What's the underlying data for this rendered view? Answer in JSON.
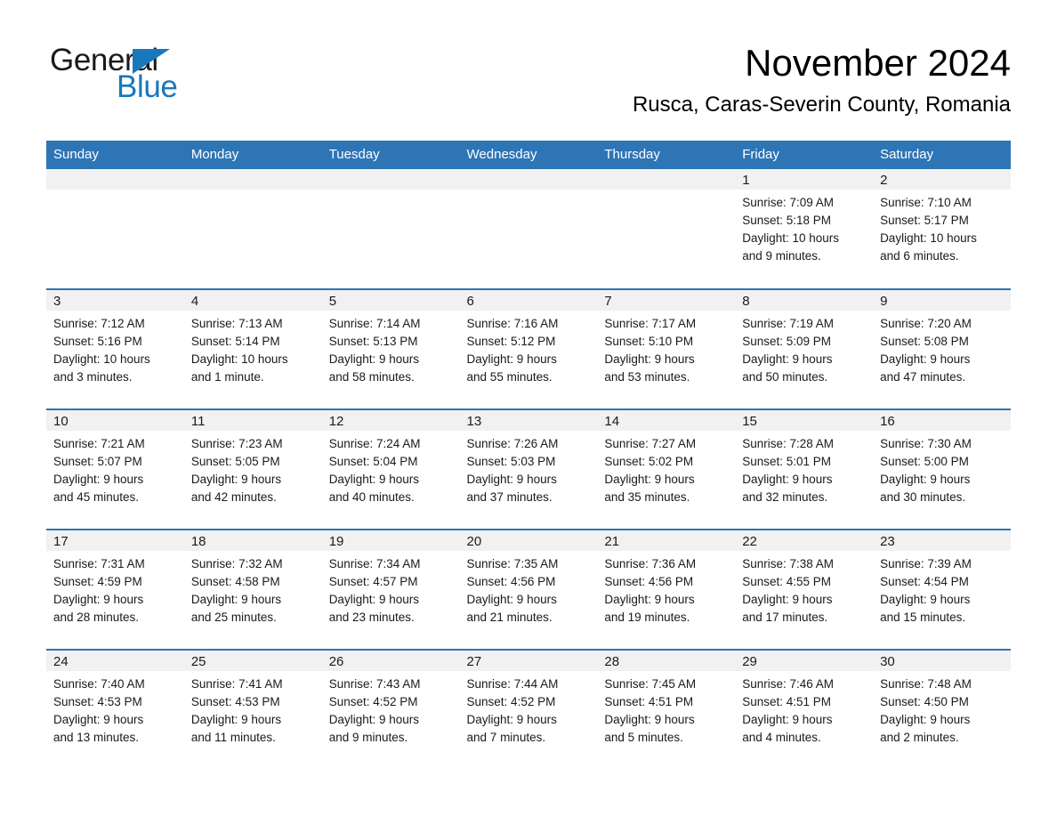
{
  "brand": {
    "name_part1": "General",
    "name_part2": "Blue",
    "accent_color": "#1878bd"
  },
  "header": {
    "title": "November 2024",
    "location": "Rusca, Caras-Severin County, Romania"
  },
  "theme": {
    "header_row_color": "#2e75b6",
    "daynum_band_color": "#f1f1f1",
    "separator_color": "#2e75b6"
  },
  "weekday_headers": [
    "Sunday",
    "Monday",
    "Tuesday",
    "Wednesday",
    "Thursday",
    "Friday",
    "Saturday"
  ],
  "weeks": [
    [
      {
        "day": "",
        "sunrise": "",
        "sunset": "",
        "daylight_line1": "",
        "daylight_line2": ""
      },
      {
        "day": "",
        "sunrise": "",
        "sunset": "",
        "daylight_line1": "",
        "daylight_line2": ""
      },
      {
        "day": "",
        "sunrise": "",
        "sunset": "",
        "daylight_line1": "",
        "daylight_line2": ""
      },
      {
        "day": "",
        "sunrise": "",
        "sunset": "",
        "daylight_line1": "",
        "daylight_line2": ""
      },
      {
        "day": "",
        "sunrise": "",
        "sunset": "",
        "daylight_line1": "",
        "daylight_line2": ""
      },
      {
        "day": "1",
        "sunrise": "Sunrise: 7:09 AM",
        "sunset": "Sunset: 5:18 PM",
        "daylight_line1": "Daylight: 10 hours",
        "daylight_line2": "and 9 minutes."
      },
      {
        "day": "2",
        "sunrise": "Sunrise: 7:10 AM",
        "sunset": "Sunset: 5:17 PM",
        "daylight_line1": "Daylight: 10 hours",
        "daylight_line2": "and 6 minutes."
      }
    ],
    [
      {
        "day": "3",
        "sunrise": "Sunrise: 7:12 AM",
        "sunset": "Sunset: 5:16 PM",
        "daylight_line1": "Daylight: 10 hours",
        "daylight_line2": "and 3 minutes."
      },
      {
        "day": "4",
        "sunrise": "Sunrise: 7:13 AM",
        "sunset": "Sunset: 5:14 PM",
        "daylight_line1": "Daylight: 10 hours",
        "daylight_line2": "and 1 minute."
      },
      {
        "day": "5",
        "sunrise": "Sunrise: 7:14 AM",
        "sunset": "Sunset: 5:13 PM",
        "daylight_line1": "Daylight: 9 hours",
        "daylight_line2": "and 58 minutes."
      },
      {
        "day": "6",
        "sunrise": "Sunrise: 7:16 AM",
        "sunset": "Sunset: 5:12 PM",
        "daylight_line1": "Daylight: 9 hours",
        "daylight_line2": "and 55 minutes."
      },
      {
        "day": "7",
        "sunrise": "Sunrise: 7:17 AM",
        "sunset": "Sunset: 5:10 PM",
        "daylight_line1": "Daylight: 9 hours",
        "daylight_line2": "and 53 minutes."
      },
      {
        "day": "8",
        "sunrise": "Sunrise: 7:19 AM",
        "sunset": "Sunset: 5:09 PM",
        "daylight_line1": "Daylight: 9 hours",
        "daylight_line2": "and 50 minutes."
      },
      {
        "day": "9",
        "sunrise": "Sunrise: 7:20 AM",
        "sunset": "Sunset: 5:08 PM",
        "daylight_line1": "Daylight: 9 hours",
        "daylight_line2": "and 47 minutes."
      }
    ],
    [
      {
        "day": "10",
        "sunrise": "Sunrise: 7:21 AM",
        "sunset": "Sunset: 5:07 PM",
        "daylight_line1": "Daylight: 9 hours",
        "daylight_line2": "and 45 minutes."
      },
      {
        "day": "11",
        "sunrise": "Sunrise: 7:23 AM",
        "sunset": "Sunset: 5:05 PM",
        "daylight_line1": "Daylight: 9 hours",
        "daylight_line2": "and 42 minutes."
      },
      {
        "day": "12",
        "sunrise": "Sunrise: 7:24 AM",
        "sunset": "Sunset: 5:04 PM",
        "daylight_line1": "Daylight: 9 hours",
        "daylight_line2": "and 40 minutes."
      },
      {
        "day": "13",
        "sunrise": "Sunrise: 7:26 AM",
        "sunset": "Sunset: 5:03 PM",
        "daylight_line1": "Daylight: 9 hours",
        "daylight_line2": "and 37 minutes."
      },
      {
        "day": "14",
        "sunrise": "Sunrise: 7:27 AM",
        "sunset": "Sunset: 5:02 PM",
        "daylight_line1": "Daylight: 9 hours",
        "daylight_line2": "and 35 minutes."
      },
      {
        "day": "15",
        "sunrise": "Sunrise: 7:28 AM",
        "sunset": "Sunset: 5:01 PM",
        "daylight_line1": "Daylight: 9 hours",
        "daylight_line2": "and 32 minutes."
      },
      {
        "day": "16",
        "sunrise": "Sunrise: 7:30 AM",
        "sunset": "Sunset: 5:00 PM",
        "daylight_line1": "Daylight: 9 hours",
        "daylight_line2": "and 30 minutes."
      }
    ],
    [
      {
        "day": "17",
        "sunrise": "Sunrise: 7:31 AM",
        "sunset": "Sunset: 4:59 PM",
        "daylight_line1": "Daylight: 9 hours",
        "daylight_line2": "and 28 minutes."
      },
      {
        "day": "18",
        "sunrise": "Sunrise: 7:32 AM",
        "sunset": "Sunset: 4:58 PM",
        "daylight_line1": "Daylight: 9 hours",
        "daylight_line2": "and 25 minutes."
      },
      {
        "day": "19",
        "sunrise": "Sunrise: 7:34 AM",
        "sunset": "Sunset: 4:57 PM",
        "daylight_line1": "Daylight: 9 hours",
        "daylight_line2": "and 23 minutes."
      },
      {
        "day": "20",
        "sunrise": "Sunrise: 7:35 AM",
        "sunset": "Sunset: 4:56 PM",
        "daylight_line1": "Daylight: 9 hours",
        "daylight_line2": "and 21 minutes."
      },
      {
        "day": "21",
        "sunrise": "Sunrise: 7:36 AM",
        "sunset": "Sunset: 4:56 PM",
        "daylight_line1": "Daylight: 9 hours",
        "daylight_line2": "and 19 minutes."
      },
      {
        "day": "22",
        "sunrise": "Sunrise: 7:38 AM",
        "sunset": "Sunset: 4:55 PM",
        "daylight_line1": "Daylight: 9 hours",
        "daylight_line2": "and 17 minutes."
      },
      {
        "day": "23",
        "sunrise": "Sunrise: 7:39 AM",
        "sunset": "Sunset: 4:54 PM",
        "daylight_line1": "Daylight: 9 hours",
        "daylight_line2": "and 15 minutes."
      }
    ],
    [
      {
        "day": "24",
        "sunrise": "Sunrise: 7:40 AM",
        "sunset": "Sunset: 4:53 PM",
        "daylight_line1": "Daylight: 9 hours",
        "daylight_line2": "and 13 minutes."
      },
      {
        "day": "25",
        "sunrise": "Sunrise: 7:41 AM",
        "sunset": "Sunset: 4:53 PM",
        "daylight_line1": "Daylight: 9 hours",
        "daylight_line2": "and 11 minutes."
      },
      {
        "day": "26",
        "sunrise": "Sunrise: 7:43 AM",
        "sunset": "Sunset: 4:52 PM",
        "daylight_line1": "Daylight: 9 hours",
        "daylight_line2": "and 9 minutes."
      },
      {
        "day": "27",
        "sunrise": "Sunrise: 7:44 AM",
        "sunset": "Sunset: 4:52 PM",
        "daylight_line1": "Daylight: 9 hours",
        "daylight_line2": "and 7 minutes."
      },
      {
        "day": "28",
        "sunrise": "Sunrise: 7:45 AM",
        "sunset": "Sunset: 4:51 PM",
        "daylight_line1": "Daylight: 9 hours",
        "daylight_line2": "and 5 minutes."
      },
      {
        "day": "29",
        "sunrise": "Sunrise: 7:46 AM",
        "sunset": "Sunset: 4:51 PM",
        "daylight_line1": "Daylight: 9 hours",
        "daylight_line2": "and 4 minutes."
      },
      {
        "day": "30",
        "sunrise": "Sunrise: 7:48 AM",
        "sunset": "Sunset: 4:50 PM",
        "daylight_line1": "Daylight: 9 hours",
        "daylight_line2": "and 2 minutes."
      }
    ]
  ]
}
